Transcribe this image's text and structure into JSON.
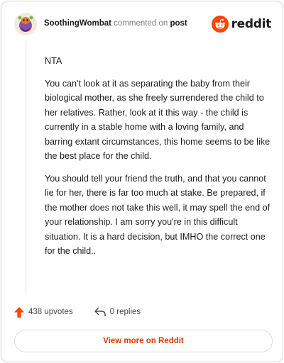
{
  "header": {
    "username": "SoothingWombat",
    "commented_on": "commented on",
    "post_link": "post",
    "brand": "reddit"
  },
  "comment": {
    "paragraphs": [
      "NTA",
      "You can't look at it as separating the baby from their biological mother, as she freely surrendered the child to her relatives. Rather, look at it this way - the child is currently in a stable home with a loving family, and barring extant circumstances, this home seems to be like the best place for the child.",
      "You should tell your friend the truth, and that you cannot lie for her, there is far too much at stake. Be prepared, if the mother does not take this well, it may spell the end of your relationship. I am sorry you're in this difficult situation. It is a hard decision, but IMHO the correct one for the child.."
    ]
  },
  "actions": {
    "upvotes": "438 upvotes",
    "replies": "0 replies"
  },
  "footer": {
    "view_more": "View more on Reddit"
  },
  "colors": {
    "upvote": "#ff4500",
    "brand_orange": "#ff4500",
    "view_more_text": "#d93a00"
  },
  "icons": {
    "avatar": "snoo-avatar",
    "brand": "reddit-logo",
    "upvote": "upvote-arrow-icon",
    "reply": "reply-icon"
  }
}
